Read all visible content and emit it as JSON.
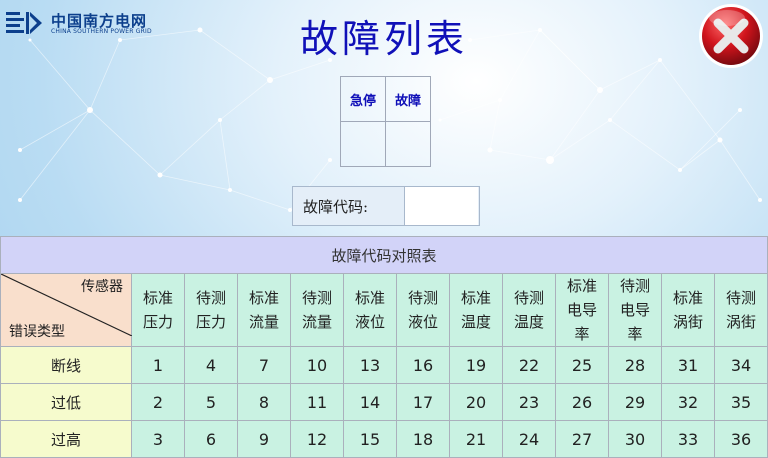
{
  "app": {
    "logo_cn": "中国南方电网",
    "logo_en": "CHINA SOUTHERN POWER GRID",
    "title": "故障列表"
  },
  "status_panel": {
    "headers": [
      "急停",
      "故障"
    ]
  },
  "fault_code": {
    "label": "故障代码:",
    "value": ""
  },
  "reference_table": {
    "caption": "故障代码对照表",
    "corner_top": "传感器",
    "corner_bottom": "错误类型",
    "columns": [
      [
        "标准",
        "压力"
      ],
      [
        "待测",
        "压力"
      ],
      [
        "标准",
        "流量"
      ],
      [
        "待测",
        "流量"
      ],
      [
        "标准",
        "液位"
      ],
      [
        "待测",
        "液位"
      ],
      [
        "标准",
        "温度"
      ],
      [
        "待测",
        "温度"
      ],
      [
        "标准",
        "电导",
        "率"
      ],
      [
        "待测",
        "电导",
        "率"
      ],
      [
        "标准",
        "涡街"
      ],
      [
        "待测",
        "涡街"
      ]
    ],
    "rows": [
      {
        "label": "断线",
        "values": [
          "1",
          "4",
          "7",
          "10",
          "13",
          "16",
          "19",
          "22",
          "25",
          "28",
          "31",
          "34"
        ]
      },
      {
        "label": "过低",
        "values": [
          "2",
          "5",
          "8",
          "11",
          "14",
          "17",
          "20",
          "23",
          "26",
          "29",
          "32",
          "35"
        ]
      },
      {
        "label": "过高",
        "values": [
          "3",
          "6",
          "9",
          "12",
          "15",
          "18",
          "21",
          "24",
          "27",
          "30",
          "33",
          "36"
        ]
      }
    ]
  },
  "colors": {
    "title": "#1010b8",
    "header_bg": "#c9f2e2",
    "caption_bg": "#d2d3f8",
    "corner_bg": "#f9dfcc",
    "row_label_bg": "#f6fbcd",
    "close_button": "#c8141e"
  },
  "icons": {
    "close": "close-x-icon",
    "logo": "power-grid-logo-icon"
  }
}
